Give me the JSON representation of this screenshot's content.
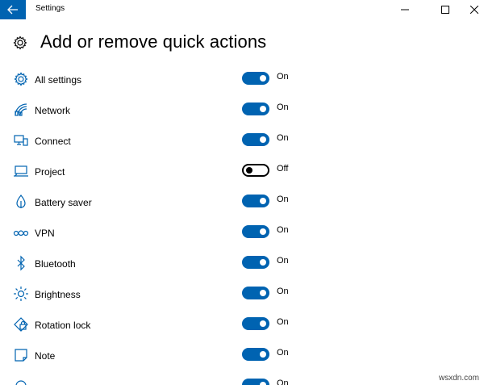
{
  "window": {
    "title": "Settings"
  },
  "page": {
    "title": "Add or remove quick actions"
  },
  "items": [
    {
      "label": "All settings",
      "state": "On",
      "on": true,
      "icon": "gear-icon"
    },
    {
      "label": "Network",
      "state": "On",
      "on": true,
      "icon": "network-icon"
    },
    {
      "label": "Connect",
      "state": "On",
      "on": true,
      "icon": "connect-icon"
    },
    {
      "label": "Project",
      "state": "Off",
      "on": false,
      "icon": "project-icon"
    },
    {
      "label": "Battery saver",
      "state": "On",
      "on": true,
      "icon": "battery-saver-icon"
    },
    {
      "label": "VPN",
      "state": "On",
      "on": true,
      "icon": "vpn-icon"
    },
    {
      "label": "Bluetooth",
      "state": "On",
      "on": true,
      "icon": "bluetooth-icon"
    },
    {
      "label": "Brightness",
      "state": "On",
      "on": true,
      "icon": "brightness-icon"
    },
    {
      "label": "Rotation lock",
      "state": "On",
      "on": true,
      "icon": "rotation-lock-icon"
    },
    {
      "label": "Note",
      "state": "On",
      "on": true,
      "icon": "note-icon"
    },
    {
      "label": "",
      "state": "On",
      "on": true,
      "icon": "unknown-icon"
    }
  ],
  "watermark": "wsxdn.com",
  "colors": {
    "accent": "#0063b1"
  }
}
